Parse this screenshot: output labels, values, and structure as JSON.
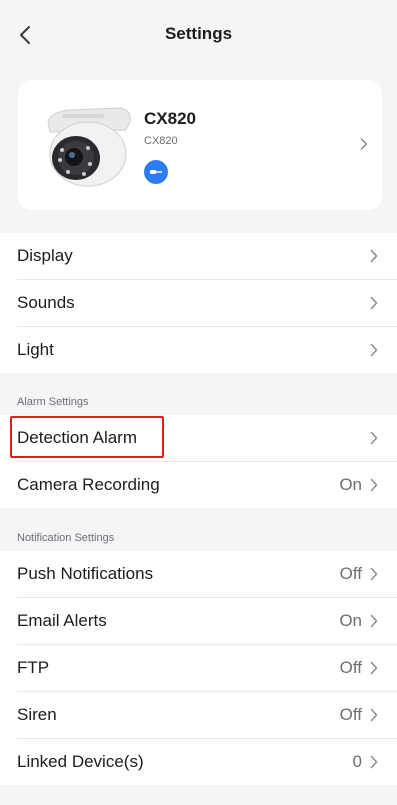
{
  "header": {
    "title": "Settings",
    "back_icon": "chevron-left-icon"
  },
  "device": {
    "name": "CX820",
    "model": "CX820",
    "badge_icon": "ethernet-icon",
    "badge_color": "#2d7cf6"
  },
  "group_general": {
    "items": [
      {
        "label": "Display",
        "value": ""
      },
      {
        "label": "Sounds",
        "value": ""
      },
      {
        "label": "Light",
        "value": ""
      }
    ]
  },
  "alarm": {
    "section_label": "Alarm Settings",
    "items": [
      {
        "label": "Detection Alarm",
        "value": ""
      },
      {
        "label": "Camera Recording",
        "value": "On"
      }
    ]
  },
  "notification": {
    "section_label": "Notification Settings",
    "items": [
      {
        "label": "Push Notifications",
        "value": "Off"
      },
      {
        "label": "Email Alerts",
        "value": "On"
      },
      {
        "label": "FTP",
        "value": "Off"
      },
      {
        "label": "Siren",
        "value": "Off"
      },
      {
        "label": "Linked Device(s)",
        "value": "0"
      }
    ]
  },
  "colors": {
    "highlight": "#e0201b",
    "background": "#f5f5f7"
  }
}
